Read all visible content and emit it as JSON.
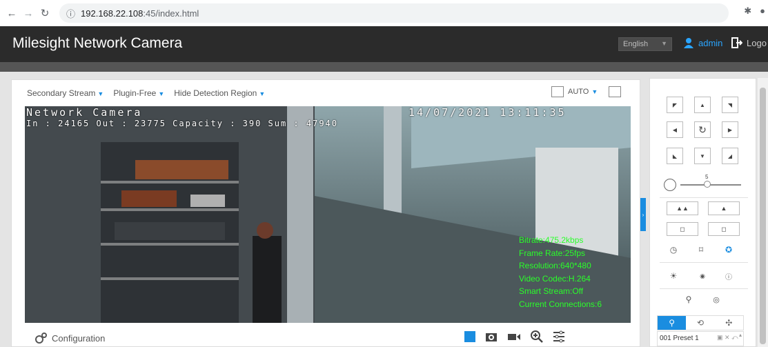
{
  "browser": {
    "url_host": "192.168.22.108",
    "url_path": ":45/index.html"
  },
  "header": {
    "title": "Milesight Network Camera",
    "language": "English",
    "user": "admin",
    "logout": "Logo",
    "accent": "#2aa5ff"
  },
  "toolbar": {
    "stream": "Secondary Stream",
    "plugin": "Plugin-Free",
    "detection": "Hide Detection Region",
    "zoom_mode": "AUTO"
  },
  "video": {
    "osd_title": "Network Camera",
    "osd_datetime": "14/07/2021  13:11:35",
    "osd_counter": "In : 24165  Out : 23775  Capacity : 390  Sum : 47940",
    "stats": [
      "Bitrate:475.2kbps",
      "Frame Rate:25fps",
      "Resolution:640*480",
      "Video Codec:H.264",
      "Smart Stream:Off",
      "Current Connections:6"
    ]
  },
  "bottom": {
    "config_label": "Configuration"
  },
  "ptz": {
    "speed": "5",
    "preset_label": "001 Preset 1"
  }
}
